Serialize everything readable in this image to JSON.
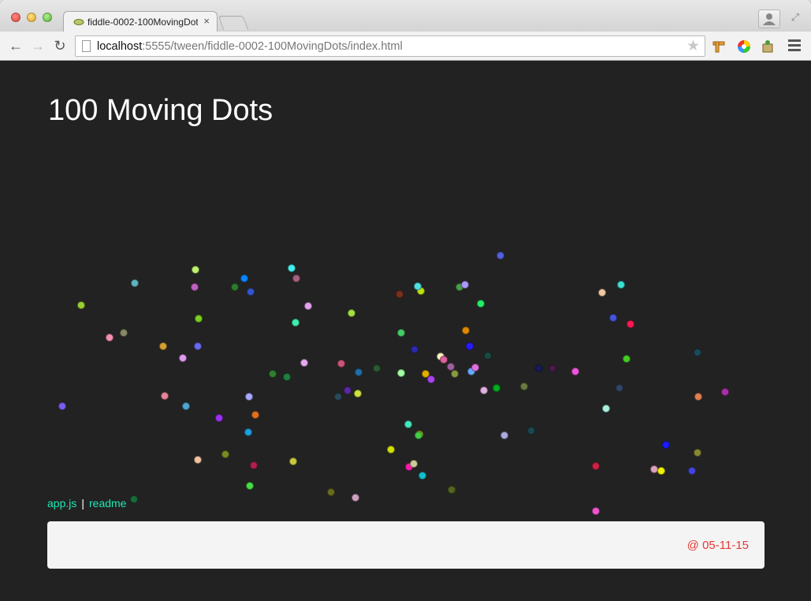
{
  "browser": {
    "tab_title": "fiddle-0002-100MovingDots",
    "tab_close": "×",
    "url_host": "localhost",
    "url_rest": ":5555/tween/fiddle-0002-100MovingDots/index.html",
    "star": "★",
    "back": "←",
    "forward": "→",
    "reload": "↻",
    "fullscreen": "⤢"
  },
  "page": {
    "title": "100 Moving Dots",
    "links": [
      {
        "label": "app.js"
      },
      {
        "label": "readme"
      }
    ],
    "link_separator": "|",
    "date": "@ 05-11-15"
  },
  "dots": [
    [
      "#7a5cf0"
    ],
    [
      "#9acd32"
    ],
    [
      "#f48fb1"
    ],
    [
      "#888866"
    ],
    [
      "#5fb3c0"
    ],
    [
      "#d4a030"
    ],
    [
      "#e29aee"
    ],
    [
      "#1a6b3a"
    ],
    [
      "#e8839a"
    ],
    [
      "#4ea6d0"
    ],
    [
      "#c0f070"
    ],
    [
      "#c060c0"
    ],
    [
      "#7ad020"
    ],
    [
      "#6a6aef"
    ],
    [
      "#f2c2a0"
    ],
    [
      "#2d7a2d"
    ],
    [
      "#0a84ff"
    ],
    [
      "#3355cc"
    ],
    [
      "#9b30f0"
    ],
    [
      "#1aa0e0"
    ],
    [
      "#7a8a20"
    ],
    [
      "#e07020"
    ],
    [
      "#b02050"
    ],
    [
      "#a8a8ff"
    ],
    [
      "#44dd44"
    ],
    [
      "#44eeee"
    ],
    [
      "#a86080"
    ],
    [
      "#e6a0f0"
    ],
    [
      "#3ef0b0"
    ],
    [
      "#a0e040"
    ],
    [
      "#308030"
    ],
    [
      "#208040"
    ],
    [
      "#cc5577"
    ],
    [
      "#1e6eaa"
    ],
    [
      "#2a5a30"
    ],
    [
      "#5a2aa0"
    ],
    [
      "#2a4a5a"
    ],
    [
      "#d0e040"
    ],
    [
      "#e8a8f0"
    ],
    [
      "#c8c840"
    ],
    [
      "#5560dd"
    ],
    [
      "#6a6a20"
    ],
    [
      "#d0a0c0"
    ],
    [
      "#606020"
    ],
    [
      "#c05020"
    ],
    [
      "#44cc66"
    ],
    [
      "#b9e010"
    ],
    [
      "#44e8c0"
    ],
    [
      "#50e0e0"
    ],
    [
      "#2a2aaa"
    ],
    [
      "#fff8c0"
    ],
    [
      "#e060a0"
    ],
    [
      "#a060a0"
    ],
    [
      "#889944"
    ],
    [
      "#e0b000"
    ],
    [
      "#aa44ee"
    ],
    [
      "#66aaff"
    ],
    [
      "#30c030"
    ],
    [
      "#4a9a4a"
    ],
    [
      "#e070e0"
    ],
    [
      "#e0f020"
    ],
    [
      "#22ee66"
    ],
    [
      "#44cc44"
    ],
    [
      "#d0e000"
    ],
    [
      "#60e0f0"
    ],
    [
      "#1a4a40"
    ],
    [
      "#aaaadd"
    ],
    [
      "#7a3020"
    ],
    [
      "#dd8800"
    ],
    [
      "#2a1aff"
    ],
    [
      "#1a1a5a"
    ],
    [
      "#e0b0e0"
    ],
    [
      "#00aa22"
    ],
    [
      "#6a7a40"
    ],
    [
      "#1a4a50"
    ],
    [
      "#aa99ff"
    ],
    [
      "#f0c8a0"
    ],
    [
      "#3ae0d0"
    ],
    [
      "#4455dd"
    ],
    [
      "#ff1a55"
    ],
    [
      "#44cc22"
    ],
    [
      "#4a1a4a"
    ],
    [
      "#ee55dd"
    ],
    [
      "#334466"
    ],
    [
      "#aaf0e0"
    ],
    [
      "#1a4a5a"
    ],
    [
      "#e08050"
    ],
    [
      "#aa30aa"
    ],
    [
      "#1a1aff"
    ],
    [
      "#888833"
    ],
    [
      "#4444dd"
    ],
    [
      "#cc2244"
    ],
    [
      "#ee55cc"
    ],
    [
      "#dda0c0"
    ],
    [
      "#f0f000"
    ],
    [
      "#10c0cc"
    ],
    [
      "#ff1aaa"
    ],
    [
      "#cccc99"
    ],
    [
      "#556622"
    ],
    [
      "#a0ffa0"
    ]
  ]
}
